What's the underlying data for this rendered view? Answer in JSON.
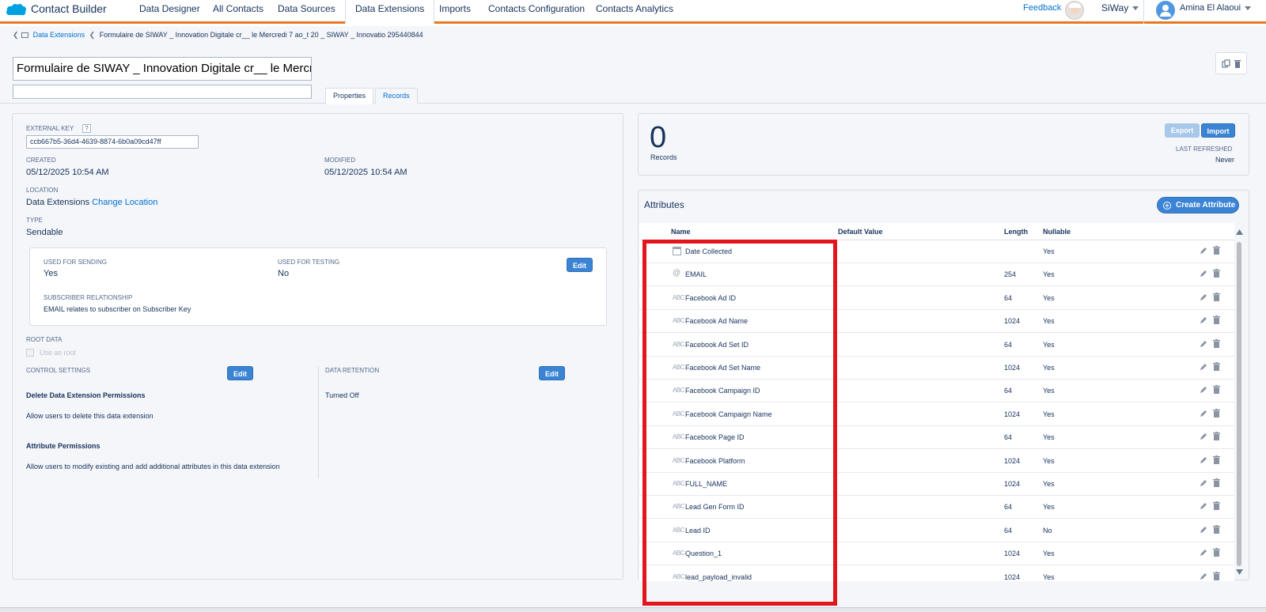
{
  "nav": {
    "app_title": "Contact Builder",
    "tabs": [
      {
        "label": "Data Designer"
      },
      {
        "label": "All Contacts"
      },
      {
        "label": "Data Sources"
      },
      {
        "label": "Data Extensions"
      },
      {
        "label": "Imports"
      },
      {
        "label": "Contacts Configuration"
      },
      {
        "label": "Contacts Analytics"
      }
    ],
    "active_tab": "Data Extensions",
    "feedback": "Feedback",
    "business_unit": "SiWay",
    "user_name": "Amina El Alaoui"
  },
  "breadcrumb": {
    "root": "Data Extensions",
    "current": "Formulaire de SIWAY _ Innovation Digitale cr__ le Mercredi 7 ao_t 20 _ SIWAY _ Innovatio 295440844"
  },
  "header": {
    "title_value": "Formulaire de SIWAY _ Innovation Digitale cr__ le Mercr",
    "description_value": "",
    "tabs": [
      "Properties",
      "Records"
    ]
  },
  "properties": {
    "external_key_label": "EXTERNAL KEY",
    "help": "?",
    "external_key_value": "ccb667b5-36d4-4639-8874-6b0a09cd47ff",
    "created_label": "CREATED",
    "created_value": "05/12/2025 10:54 AM",
    "modified_label": "MODIFIED",
    "modified_value": "05/12/2025 10:54 AM",
    "location_label": "LOCATION",
    "location_value": "Data Extensions",
    "change_location": "Change Location",
    "type_label": "TYPE",
    "type_value": "Sendable",
    "used_for_sending_label": "USED FOR SENDING",
    "used_for_sending_value": "Yes",
    "used_for_testing_label": "USED FOR TESTING",
    "used_for_testing_value": "No",
    "edit": "Edit",
    "subscriber_relationship_label": "SUBSCRIBER RELATIONSHIP",
    "subscriber_relationship_value": "EMAIL relates to subscriber on Subscriber Key",
    "root_data_label": "ROOT DATA",
    "use_as_root": "Use as root",
    "control_settings_label": "CONTROL SETTINGS",
    "data_retention_label": "DATA RETENTION",
    "data_retention_value": "Turned Off",
    "delete_perm_title": "Delete Data Extension Permissions",
    "delete_perm_text": "Allow users to delete this data extension",
    "attr_perm_title": "Attribute Permissions",
    "attr_perm_text": "Allow users to modify existing and add additional attributes in this data extension"
  },
  "records": {
    "count": "0",
    "label": "Records",
    "export": "Export",
    "import": "Import",
    "last_refreshed_label": "LAST REFRESHED",
    "last_refreshed_value": "Never"
  },
  "attributes": {
    "title": "Attributes",
    "create_button": "Create Attribute",
    "columns": [
      "Name",
      "Default Value",
      "Length",
      "Nullable"
    ],
    "rows": [
      {
        "type": "date",
        "name": "Date Collected",
        "default": "",
        "length": "",
        "nullable": "Yes"
      },
      {
        "type": "email",
        "name": "EMAIL",
        "default": "",
        "length": "254",
        "nullable": "Yes"
      },
      {
        "type": "text",
        "name": "Facebook Ad ID",
        "default": "",
        "length": "64",
        "nullable": "Yes"
      },
      {
        "type": "text",
        "name": "Facebook Ad Name",
        "default": "",
        "length": "1024",
        "nullable": "Yes"
      },
      {
        "type": "text",
        "name": "Facebook Ad Set ID",
        "default": "",
        "length": "64",
        "nullable": "Yes"
      },
      {
        "type": "text",
        "name": "Facebook Ad Set Name",
        "default": "",
        "length": "1024",
        "nullable": "Yes"
      },
      {
        "type": "text",
        "name": "Facebook Campaign ID",
        "default": "",
        "length": "64",
        "nullable": "Yes"
      },
      {
        "type": "text",
        "name": "Facebook Campaign Name",
        "default": "",
        "length": "1024",
        "nullable": "Yes"
      },
      {
        "type": "text",
        "name": "Facebook Page ID",
        "default": "",
        "length": "64",
        "nullable": "Yes"
      },
      {
        "type": "text",
        "name": "Facebook Platform",
        "default": "",
        "length": "1024",
        "nullable": "Yes"
      },
      {
        "type": "text",
        "name": "FULL_NAME",
        "default": "",
        "length": "1024",
        "nullable": "Yes"
      },
      {
        "type": "text",
        "name": "Lead Gen Form ID",
        "default": "",
        "length": "64",
        "nullable": "Yes"
      },
      {
        "type": "text",
        "name": "Lead ID",
        "default": "",
        "length": "64",
        "nullable": "No",
        "primary_key": true
      },
      {
        "type": "text",
        "name": "Question_1",
        "default": "",
        "length": "1024",
        "nullable": "Yes"
      },
      {
        "type": "text",
        "name": "lead_payload_invalid",
        "default": "",
        "length": "1024",
        "nullable": "Yes"
      }
    ],
    "type_glyphs": {
      "text": "ABC",
      "email": "@",
      "date": ""
    }
  },
  "colors": {
    "accent_orange": "#e8771f",
    "brand_blue": "#0070d2",
    "highlight_red": "#e2151d"
  }
}
